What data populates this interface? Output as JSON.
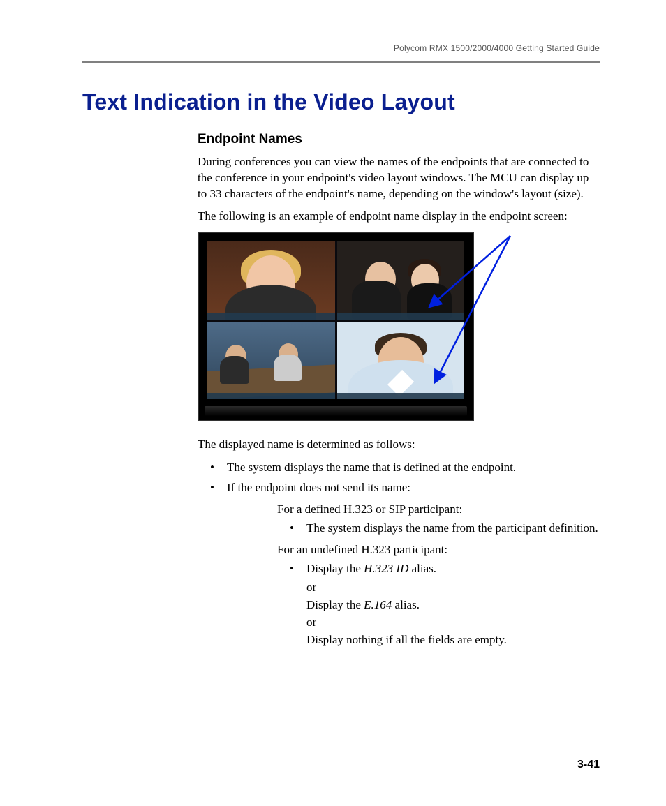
{
  "header": {
    "running_head": "Polycom RMX 1500/2000/4000 Getting Started Guide"
  },
  "heading": "Text Indication in the Video Layout",
  "subheading": "Endpoint Names",
  "paragraphs": {
    "p1": "During conferences you can view the names of the endpoints that are connected to the conference in your endpoint's video layout windows. The MCU can display up to 33 characters of the endpoint's name, depending on the window's layout (size).",
    "p2": "The following is an example of endpoint name display in the endpoint screen:",
    "p3": "The displayed name is determined as follows:"
  },
  "bullets": {
    "b1": "The system displays the name that is defined at the endpoint.",
    "b2": "If the endpoint does not send its name:"
  },
  "sub": {
    "intro1": "For a defined H.323 or SIP participant:",
    "s1": "The system displays the name from the participant definition.",
    "intro2": "For an undefined H.323 participant:",
    "s2_display_prefix": "Display the ",
    "s2_alias1_term": "H.323 ID",
    "s2_alias_suffix": " alias.",
    "or": "or",
    "s3_display_prefix": "Display the ",
    "s3_alias2_term": "E.164",
    "s3_alias_suffix": " alias.",
    "s4": "Display nothing if all the fields are empty."
  },
  "page_number": "3-41"
}
